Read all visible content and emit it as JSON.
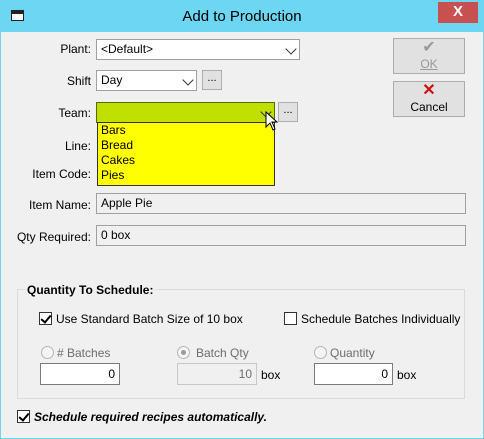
{
  "window": {
    "title": "Add to Production",
    "close_label": "X"
  },
  "form": {
    "plant_label": "Plant:",
    "plant_value": "<Default>",
    "shift_label": "Shift",
    "shift_value": "Day",
    "team_label": "Team:",
    "team_value": "",
    "line_label": "Line:",
    "item_code_label": "Item Code:",
    "item_name_label": "Item Name:",
    "item_name_value": "Apple Pie",
    "qty_required_label": "Qty Required:",
    "qty_required_value": "0 box",
    "browse_label": "..."
  },
  "team_dropdown": {
    "options": [
      "Bars",
      "Bread",
      "Cakes",
      "Pies"
    ],
    "highlight_color": "#ffff00"
  },
  "buttons": {
    "ok_label": "OK",
    "ok_icon": "checkmark-icon",
    "ok_enabled": false,
    "cancel_label": "Cancel",
    "cancel_icon": "x-icon"
  },
  "quantity_group": {
    "title": "Quantity To Schedule:",
    "use_standard_label": "Use Standard Batch Size of 10 box",
    "use_standard_checked": true,
    "individually_label": "Schedule Batches Individually",
    "individually_checked": false,
    "batches_label": "# Batches",
    "batches_value": "0",
    "batch_qty_label": "Batch Qty",
    "batch_qty_value": "10",
    "batch_qty_unit": "box",
    "quantity_label": "Quantity",
    "quantity_value": "0",
    "quantity_unit": "box"
  },
  "footer": {
    "auto_recipes_label": "Schedule required recipes automatically.",
    "auto_recipes_checked": true
  },
  "colors": {
    "titlebar": "#6dd6f2",
    "team_field": "#bfe000",
    "close": "#c75050",
    "cancel_x": "#cc1111"
  }
}
